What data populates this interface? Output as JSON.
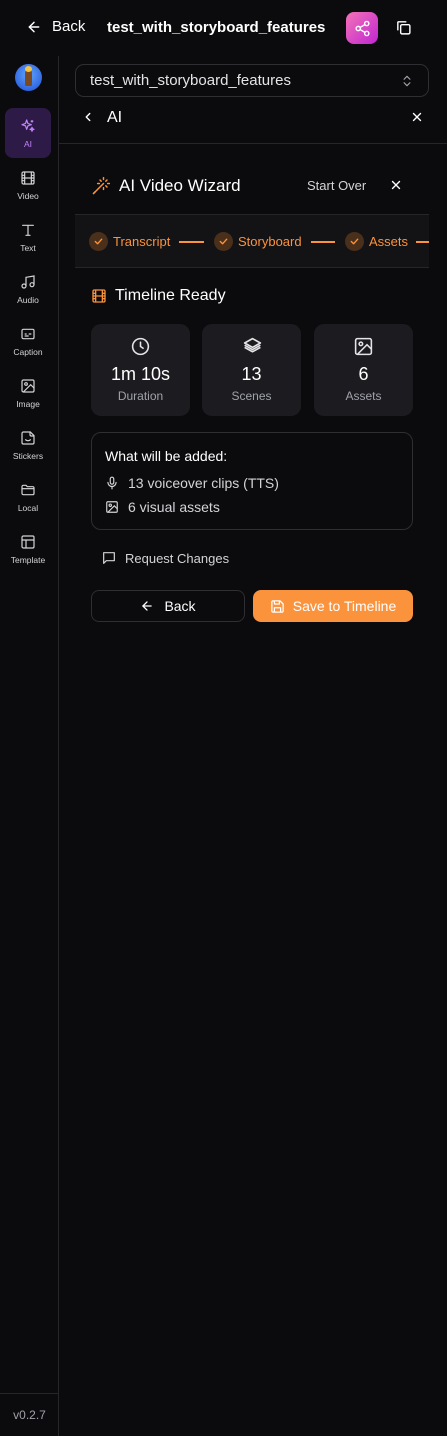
{
  "header": {
    "back_label": "Back",
    "project_title": "test_with_storyboard_features"
  },
  "sidebar": {
    "items": [
      {
        "label": "AI",
        "icon": "sparkles-icon",
        "active": true
      },
      {
        "label": "Video",
        "icon": "film-icon"
      },
      {
        "label": "Text",
        "icon": "text-icon"
      },
      {
        "label": "Audio",
        "icon": "music-icon"
      },
      {
        "label": "Caption",
        "icon": "caption-icon"
      },
      {
        "label": "Image",
        "icon": "image-icon"
      },
      {
        "label": "Stickers",
        "icon": "sticker-icon"
      },
      {
        "label": "Local",
        "icon": "folder-icon"
      },
      {
        "label": "Template",
        "icon": "template-icon"
      }
    ],
    "version": "v0.2.7"
  },
  "project_select": {
    "value": "test_with_storyboard_features"
  },
  "panel": {
    "title": "AI"
  },
  "wizard": {
    "title": "AI Video Wizard",
    "start_over": "Start Over",
    "steps": [
      {
        "label": "Transcript",
        "done": true
      },
      {
        "label": "Storyboard",
        "done": true
      },
      {
        "label": "Assets",
        "done": true
      }
    ],
    "status": "Timeline Ready",
    "stats": [
      {
        "value": "1m 10s",
        "label": "Duration",
        "icon": "clock-icon"
      },
      {
        "value": "13",
        "label": "Scenes",
        "icon": "layers-icon"
      },
      {
        "value": "6",
        "label": "Assets",
        "icon": "image-icon"
      }
    ],
    "added": {
      "title": "What will be added:",
      "items": [
        {
          "text": "13 voiceover clips (TTS)",
          "icon": "mic-icon"
        },
        {
          "text": "6 visual assets",
          "icon": "image-icon"
        }
      ]
    },
    "request_changes": "Request Changes",
    "back_button": "Back",
    "save_button": "Save to Timeline"
  },
  "colors": {
    "accent": "#fb923c",
    "ai_active": "#c084fc",
    "share_gradient_start": "#f472b6",
    "share_gradient_end": "#c026d3",
    "background": "#0b0b0d",
    "card": "#1c1c20"
  }
}
